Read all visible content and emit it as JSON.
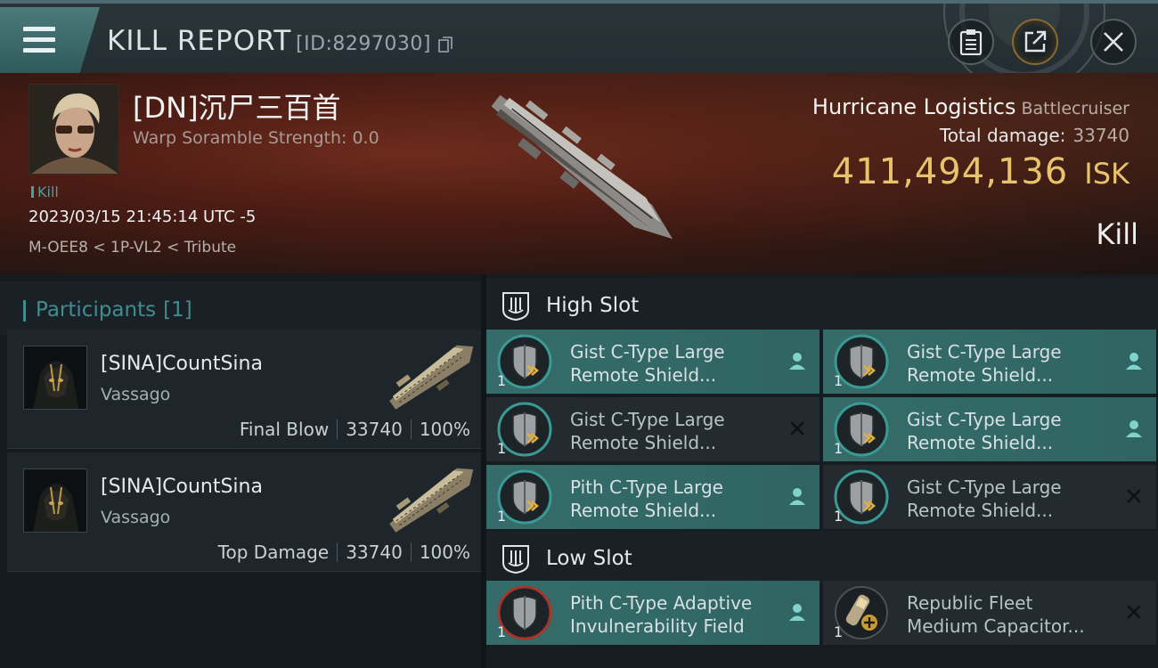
{
  "window": {
    "title": "KILL REPORT",
    "report_id": "[ID:8297030]"
  },
  "victim": {
    "name": "[DN]沉尸三百首",
    "warp_scramble": "Warp Soramble Strength: 0.0",
    "kill_tag": "Kill",
    "datetime": "2023/03/15 21:45:14 UTC -5",
    "location": "M-OEE8 < 1P-VL2 < Tribute",
    "ship_name": "Hurricane Logistics",
    "ship_class": "Battlecruiser",
    "damage_label": "Total damage:",
    "damage_value": "33740",
    "isk_value": "411,494,136",
    "isk_unit": "ISK",
    "result": "Kill"
  },
  "participants": {
    "title": "Participants",
    "count": "[1]",
    "items": [
      {
        "name": "[SINA]CountSina",
        "ship": "Vassago",
        "role": "Final Blow",
        "damage": "33740",
        "percent": "100%"
      },
      {
        "name": "[SINA]CountSina",
        "ship": "Vassago",
        "role": "Top Damage",
        "damage": "33740",
        "percent": "100%"
      }
    ]
  },
  "high_slot": {
    "label": "High Slot",
    "modules": [
      {
        "line1": "Gist C-Type Large",
        "line2": "Remote Shield...",
        "qty": "1",
        "status": "fitted",
        "icon": "shield-module-icon"
      },
      {
        "line1": "Gist C-Type Large",
        "line2": "Remote Shield...",
        "qty": "1",
        "status": "fitted",
        "icon": "shield-module-icon"
      },
      {
        "line1": "Gist C-Type Large",
        "line2": "Remote Shield...",
        "qty": "1",
        "status": "destroyed",
        "icon": "shield-module-icon"
      },
      {
        "line1": "Gist C-Type Large",
        "line2": "Remote Shield...",
        "qty": "1",
        "status": "fitted",
        "icon": "shield-module-icon"
      },
      {
        "line1": "Pith C-Type Large",
        "line2": "Remote Shield...",
        "qty": "1",
        "status": "fitted",
        "icon": "shield-module-icon"
      },
      {
        "line1": "Gist C-Type Large",
        "line2": "Remote Shield...",
        "qty": "1",
        "status": "destroyed",
        "icon": "shield-module-icon"
      }
    ]
  },
  "low_slot": {
    "label": "Low Slot",
    "modules": [
      {
        "line1": "Pith C-Type Adaptive",
        "line2": "Invulnerability Field",
        "qty": "1",
        "status": "fitted",
        "icon": "invuln-field-icon"
      },
      {
        "line1": "Republic Fleet",
        "line2": "Medium Capacitor...",
        "qty": "1",
        "status": "destroyed",
        "icon": "capacitor-icon"
      }
    ]
  },
  "colors": {
    "accent_teal": "#356c6a",
    "isk_gold": "#e8c36b",
    "participants_teal": "#3f8d91"
  }
}
